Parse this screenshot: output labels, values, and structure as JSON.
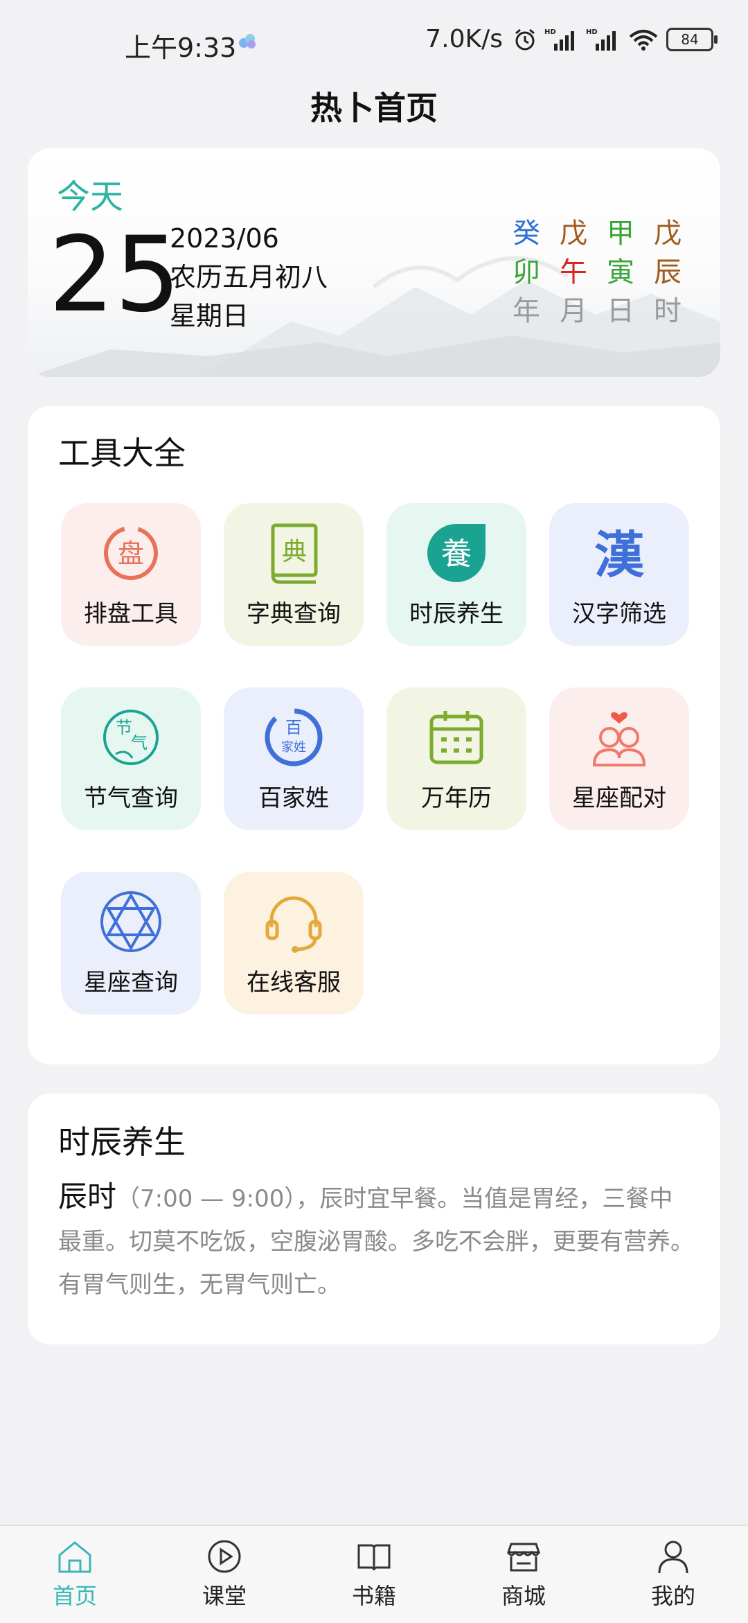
{
  "status_bar": {
    "time": "上午9:33",
    "net_speed": "7.0K/s",
    "battery": "84"
  },
  "page_title": "热卜首页",
  "today_card": {
    "today_label": "今天",
    "day": "25",
    "year_month": "2023/06",
    "lunar_date": "农历五月初八",
    "weekday": "星期日",
    "ganzhi": {
      "stems": [
        "癸",
        "戊",
        "甲",
        "戊"
      ],
      "branches": [
        "卯",
        "午",
        "寅",
        "辰"
      ],
      "labels": [
        "年",
        "月",
        "日",
        "时"
      ],
      "stem_colors": [
        "#2f6fd6",
        "#a05a1c",
        "#3aa53a",
        "#a05a1c"
      ],
      "branch_colors": [
        "#3aa53a",
        "#d7261e",
        "#3aa53a",
        "#a05a1c"
      ]
    }
  },
  "tools": {
    "title": "工具大全",
    "items": [
      {
        "label": "排盘工具",
        "icon": "pan-seal-icon",
        "bg": "#fdeeee"
      },
      {
        "label": "字典查询",
        "icon": "dictionary-book-icon",
        "bg": "#f2f5e4"
      },
      {
        "label": "时辰养生",
        "icon": "yang-health-icon",
        "bg": "#e6f7f2"
      },
      {
        "label": "汉字筛选",
        "icon": "han-character-icon",
        "bg": "#ebeffb"
      },
      {
        "label": "节气查询",
        "icon": "solar-term-icon",
        "bg": "#e6f7f2"
      },
      {
        "label": "百家姓",
        "icon": "surname-icon",
        "bg": "#ebeffb"
      },
      {
        "label": "万年历",
        "icon": "calendar-icon",
        "bg": "#f2f5e4"
      },
      {
        "label": "星座配对",
        "icon": "couple-match-icon",
        "bg": "#fdeeee"
      },
      {
        "label": "星座查询",
        "icon": "hexagram-star-icon",
        "bg": "#ebeffb"
      },
      {
        "label": "在线客服",
        "icon": "headset-icon",
        "bg": "#fdf1df"
      }
    ],
    "icon_glyphs": {
      "pan": "盘",
      "dian": "典",
      "yang": "養",
      "han": "漢",
      "jie": "节",
      "qi": "气",
      "bai": "百",
      "jiaxing": "家姓"
    }
  },
  "health": {
    "title": "时辰养生",
    "hour_name": "辰时",
    "body": "（7:00 — 9:00），辰时宜早餐。当值是胃经，三餐中最重。切莫不吃饭，空腹泌胃酸。多吃不会胖，更要有营养。有胃气则生，无胃气则亡。"
  },
  "tab_bar": {
    "tabs": [
      {
        "label": "首页",
        "icon": "home-icon",
        "active": true
      },
      {
        "label": "课堂",
        "icon": "play-icon",
        "active": false
      },
      {
        "label": "书籍",
        "icon": "book-icon",
        "active": false
      },
      {
        "label": "商城",
        "icon": "store-icon",
        "active": false
      },
      {
        "label": "我的",
        "icon": "profile-icon",
        "active": false
      }
    ]
  },
  "colors": {
    "accent": "#39b7b5",
    "today": "#2bb3a3",
    "background": "#f2f2f4"
  }
}
